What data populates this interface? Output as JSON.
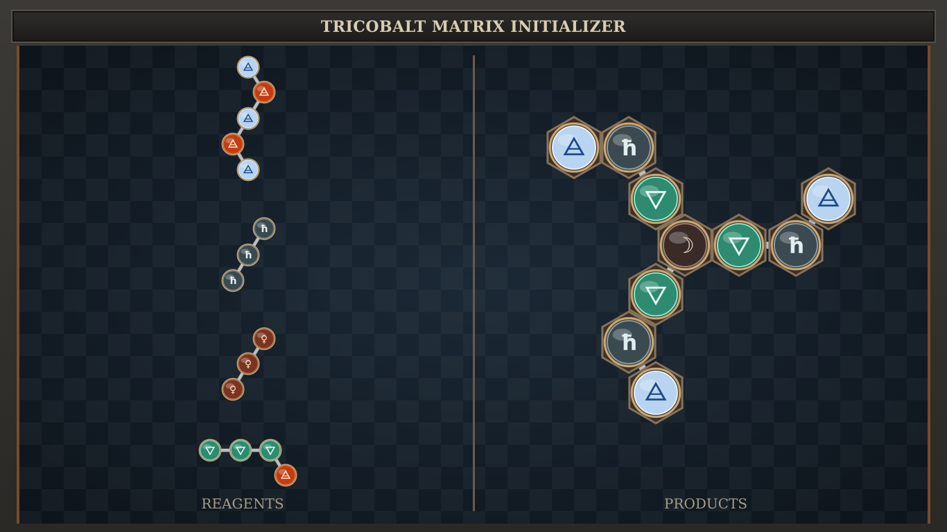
{
  "window": {
    "title": "TRICOBALT MATRIX INITIALIZER"
  },
  "panels": {
    "left_label": "REAGENTS",
    "right_label": "PRODUCTS"
  },
  "colors": {
    "board": "#141e28",
    "frame": "#3b3a36",
    "border_accent": "#7a4a2c",
    "label_text": "#a89c88",
    "title_text": "#d8cdb5"
  },
  "atom_types": {
    "air": {
      "glyph": "🜁",
      "element": "air",
      "fill": "#b8d4f0",
      "stroke": "#e8f2ff",
      "text": "#1e4a8a"
    },
    "fire": {
      "glyph": "🜂",
      "element": "fire",
      "fill": "#c43c14",
      "stroke": "#ff8a40",
      "text": "#ffe8c0"
    },
    "water": {
      "glyph": "🜄",
      "element": "water",
      "fill": "#2e8a70",
      "stroke": "#8ff0d0",
      "text": "#e8fff8"
    },
    "lead": {
      "glyph": "♄",
      "element": "lead",
      "fill": "#3a4a50",
      "stroke": "#8aa0a8",
      "text": "#e0eef0"
    },
    "copper": {
      "glyph": "♀",
      "element": "copper",
      "fill": "#7a3420",
      "stroke": "#d0805a",
      "text": "#ffe0c8"
    },
    "silver": {
      "glyph": "☽",
      "element": "silver",
      "fill": "#3a2a28",
      "stroke": "#a08070",
      "text": "#f0e0d0"
    }
  },
  "reagents": [
    {
      "name": "reagent-1",
      "atoms": [
        "air",
        "fire",
        "air",
        "fire",
        "air"
      ]
    },
    {
      "name": "reagent-2",
      "atoms": [
        "lead",
        "lead",
        "lead"
      ]
    },
    {
      "name": "reagent-3",
      "atoms": [
        "copper",
        "copper",
        "copper"
      ]
    },
    {
      "name": "reagent-4",
      "atoms": [
        "water",
        "water",
        "water",
        "fire"
      ]
    }
  ],
  "product": {
    "name": "product-1",
    "atoms": [
      "air",
      "lead",
      "water",
      "silver",
      "water",
      "lead",
      "air",
      "water",
      "lead",
      "air"
    ]
  }
}
